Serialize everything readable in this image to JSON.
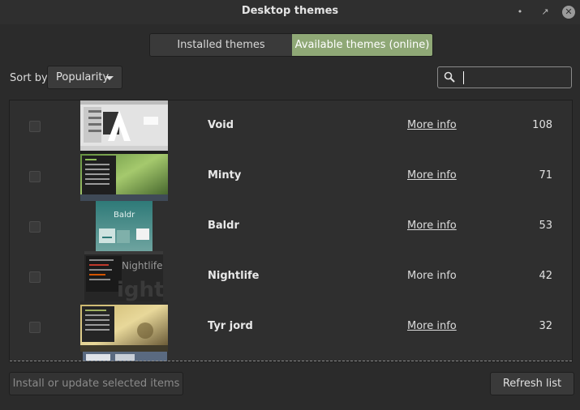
{
  "window": {
    "title": "Desktop themes"
  },
  "tabs": [
    {
      "label": "Installed themes",
      "active": false
    },
    {
      "label": "Available themes (online)",
      "active": true
    }
  ],
  "sort": {
    "label": "Sort by",
    "selected": "Popularity"
  },
  "search": {
    "value": "",
    "icon": "search-icon"
  },
  "themes": [
    {
      "name": "Void",
      "more_info": "More info",
      "score": "108"
    },
    {
      "name": "Minty",
      "more_info": "More info",
      "score": "71"
    },
    {
      "name": "Baldr",
      "more_info": "More info",
      "score": "53"
    },
    {
      "name": "Nightlife",
      "more_info": "More info",
      "score": "42"
    },
    {
      "name": "Tyr jord",
      "more_info": "More info",
      "score": "32"
    }
  ],
  "buttons": {
    "install": "Install or update selected items",
    "refresh": "Refresh list"
  },
  "colors": {
    "accent": "#8fa876",
    "background": "#2b2b2b",
    "titlebar": "#2f2f2f"
  }
}
